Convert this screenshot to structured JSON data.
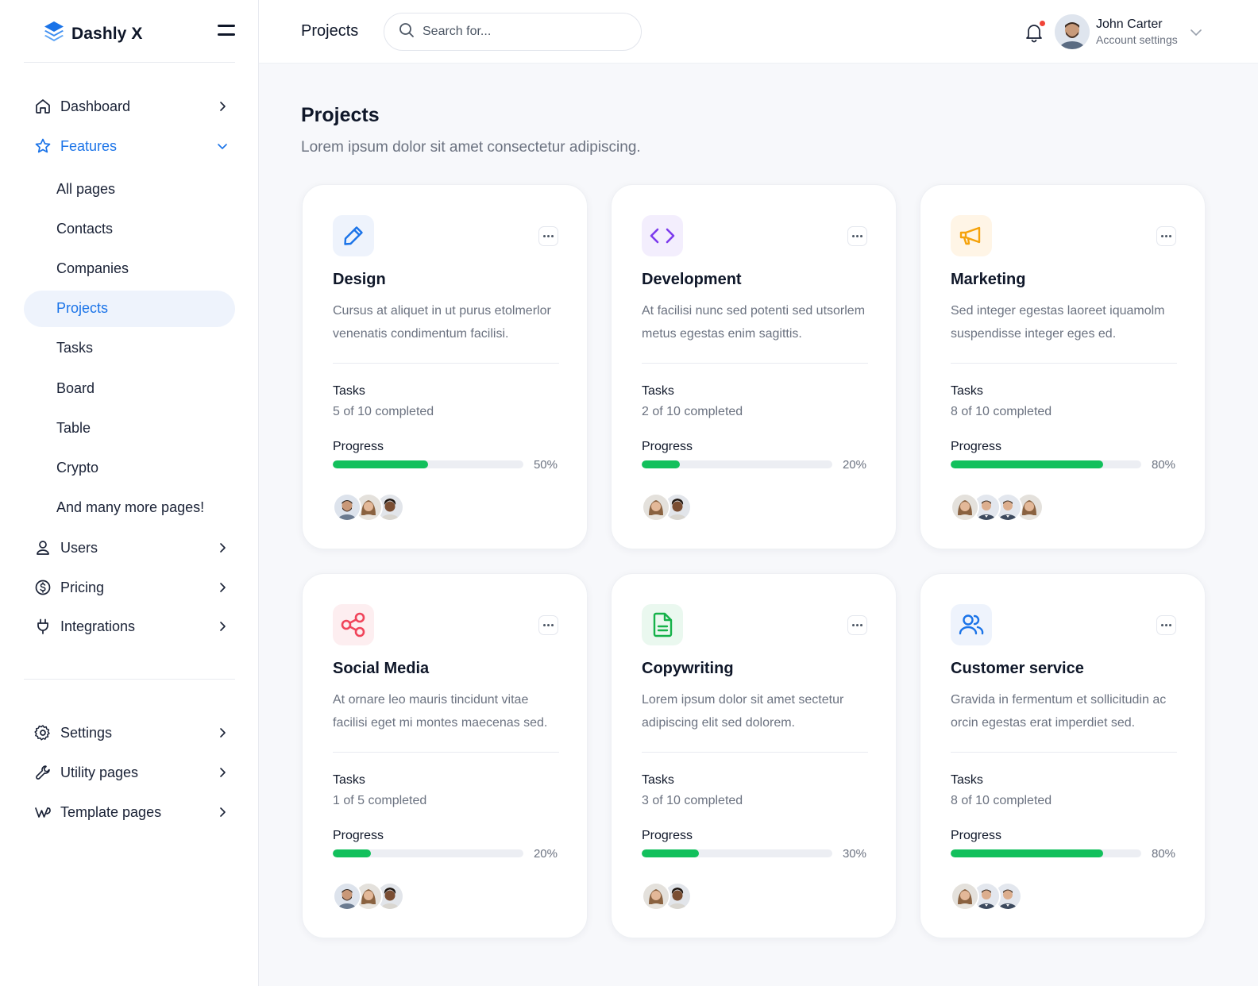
{
  "brand": {
    "name": "Dashly X",
    "accent": "#1a73e8"
  },
  "sidebar": {
    "items_top": [
      {
        "label": "Dashboard",
        "icon": "home-icon"
      },
      {
        "label": "Features",
        "icon": "star-icon",
        "expanded": true
      }
    ],
    "sub_items": [
      {
        "label": "All pages"
      },
      {
        "label": "Contacts"
      },
      {
        "label": "Companies"
      },
      {
        "label": "Projects",
        "active": true
      },
      {
        "label": "Tasks"
      },
      {
        "label": "Board"
      },
      {
        "label": "Table"
      },
      {
        "label": "Crypto"
      },
      {
        "label": "And many more pages!"
      }
    ],
    "items_mid": [
      {
        "label": "Users",
        "icon": "user-icon"
      },
      {
        "label": "Pricing",
        "icon": "dollar-icon"
      },
      {
        "label": "Integrations",
        "icon": "plug-icon"
      }
    ],
    "items_bottom": [
      {
        "label": "Settings",
        "icon": "gear-icon"
      },
      {
        "label": "Utility pages",
        "icon": "wrench-icon"
      },
      {
        "label": "Template pages",
        "icon": "webflow-icon"
      }
    ]
  },
  "topbar": {
    "title": "Projects",
    "search_placeholder": "Search for...",
    "user": {
      "name": "John Carter",
      "subtitle": "Account settings"
    }
  },
  "main": {
    "title": "Projects",
    "subtitle": "Lorem ipsum dolor sit amet consectetur adipiscing."
  },
  "labels": {
    "tasks": "Tasks",
    "progress": "Progress"
  },
  "projects": [
    {
      "title": "Design",
      "icon": "pencil-icon",
      "color": "#1a73e8",
      "bg": "#eef3fc",
      "desc": "Cursus at aliquet in ut purus etolmerlor venenatis condimentum facilisi.",
      "tasks": "5 of 10 completed",
      "progress": 50,
      "progress_label": "50%",
      "avatars": [
        "man-beard",
        "woman",
        "man-curly"
      ]
    },
    {
      "title": "Development",
      "icon": "code-icon",
      "color": "#7c3aed",
      "bg": "#f3eefd",
      "desc": "At facilisi nunc sed potenti sed utsorlem metus egestas enim sagittis.",
      "tasks": "2 of 10 completed",
      "progress": 20,
      "progress_label": "20%",
      "avatars": [
        "woman",
        "man-curly"
      ]
    },
    {
      "title": "Marketing",
      "icon": "megaphone-icon",
      "color": "#f5a20a",
      "bg": "#fff5e6",
      "desc": "Sed integer egestas laoreet iquamolm suspendisse integer eges ed.",
      "tasks": "8 of 10 completed",
      "progress": 80,
      "progress_label": "80%",
      "avatars": [
        "woman",
        "man-suit",
        "man-suit",
        "woman"
      ]
    },
    {
      "title": "Social Media",
      "icon": "share-icon",
      "color": "#f0445a",
      "bg": "#fdeef0",
      "desc": "At ornare leo mauris tincidunt vitae facilisi eget mi montes maecenas sed.",
      "tasks": "1 of 5 completed",
      "progress": 20,
      "progress_label": "20%",
      "avatars": [
        "man-beard",
        "woman",
        "man-curly"
      ]
    },
    {
      "title": "Copywriting",
      "icon": "document-icon",
      "color": "#16b24a",
      "bg": "#eaf8ef",
      "desc": "Lorem ipsum dolor sit amet sectetur adipiscing elit sed dolorem.",
      "tasks": "3 of 10 completed",
      "progress": 30,
      "progress_label": "30%",
      "avatars": [
        "woman",
        "man-curly"
      ]
    },
    {
      "title": "Customer service",
      "icon": "users-icon",
      "color": "#1a73e8",
      "bg": "#eef3fc",
      "desc": "Gravida in fermentum et sollicitudin ac orcin egestas erat imperdiet sed.",
      "tasks": "8 of 10 completed",
      "progress": 80,
      "progress_label": "80%",
      "avatars": [
        "woman",
        "man-suit",
        "man-suit"
      ]
    }
  ]
}
